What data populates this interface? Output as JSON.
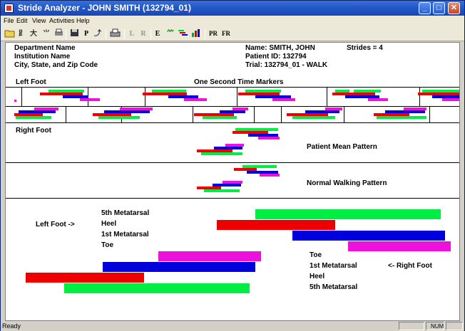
{
  "window": {
    "title": "Stride Analyzer - JOHN SMITH (132794_01)"
  },
  "menu": [
    "File",
    "Edit",
    "View",
    "Activities",
    "Help"
  ],
  "toolbar": {
    "icons": [
      "open-folder-icon",
      "walker-icon",
      "runner-icon",
      "cane-icon",
      "print-preview-icon",
      "save-icon",
      "p-label",
      "export-icon",
      "print-icon"
    ],
    "letters": [
      {
        "label": "P",
        "enabled": true
      },
      {
        "label": "L",
        "enabled": false
      },
      {
        "label": "R",
        "enabled": false
      },
      {
        "label": "E",
        "enabled": true
      },
      {
        "label": "PR",
        "enabled": true
      },
      {
        "label": "FR",
        "enabled": true
      }
    ]
  },
  "header": {
    "department": "Department Name",
    "institution": "Institution Name",
    "address": "City, State, and Zip Code",
    "name_line": "Name:  SMITH, JOHN",
    "strides": "Strides = 4",
    "patient_id": "Patient ID:  132794",
    "trial": "Trial:  132794_01 - WALK"
  },
  "timeline": {
    "left_foot_label": "Left Foot",
    "markers_label": "One Second Time Markers",
    "right_foot_label": "Right Foot"
  },
  "patterns": {
    "patient_mean": "Patient Mean Pattern",
    "normal_walking": "Normal Walking Pattern"
  },
  "legend": {
    "left_foot": "Left Foot ->",
    "right_foot": "<- Right Foot",
    "left_labels": [
      "5th Metatarsal",
      "Heel",
      "1st Metatarsal",
      "Toe"
    ],
    "right_labels": [
      "Toe",
      "1st Metatarsal",
      "Heel",
      "5th Metatarsal"
    ]
  },
  "colors": {
    "fifth_metatarsal": "#00ee44",
    "heel": "#ee0000",
    "first_metatarsal": "#0000dd",
    "toe": "#ee11dd"
  },
  "status": {
    "text": "Ready",
    "num": "NUM"
  }
}
